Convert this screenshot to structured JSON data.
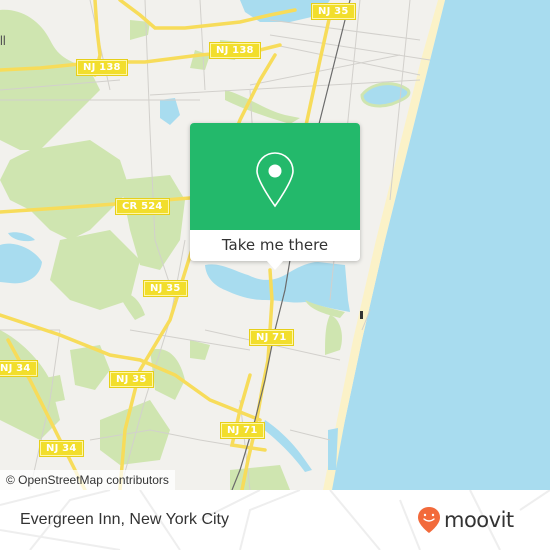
{
  "map": {
    "colors": {
      "land": "#f2f1ed",
      "water": "#a8dcef",
      "park": "#cfe5b0",
      "beach": "#fbf2c8",
      "highway": "#f7dc5a",
      "minor_road": "#d2d0cc",
      "rail": "#6b6b6b"
    },
    "road_labels": [
      {
        "id": "nj35-north",
        "text": "NJ 35"
      },
      {
        "id": "nj138-west",
        "text": "NJ 138"
      },
      {
        "id": "nj138-east",
        "text": "NJ 138"
      },
      {
        "id": "cr524",
        "text": "CR 524"
      },
      {
        "id": "nj35-mid",
        "text": "NJ 35"
      },
      {
        "id": "nj71-north",
        "text": "NJ 71"
      },
      {
        "id": "nj34-west",
        "text": "NJ 34"
      },
      {
        "id": "nj35-south",
        "text": "NJ 35"
      },
      {
        "id": "nj71-south",
        "text": "NJ 71"
      },
      {
        "id": "nj34-south",
        "text": "NJ 34"
      }
    ],
    "edge_label_fragment": "ll"
  },
  "popup": {
    "icon": "map-pin-icon",
    "button_label": "Take me there",
    "accent_color": "#23b96b"
  },
  "attribution": {
    "text": "© OpenStreetMap contributors"
  },
  "footer": {
    "place_name": "Evergreen Inn, New York City",
    "brand": {
      "name": "moovit",
      "logo_icon": "moovit-pin-icon",
      "logo_color": "#f26a3b"
    }
  }
}
